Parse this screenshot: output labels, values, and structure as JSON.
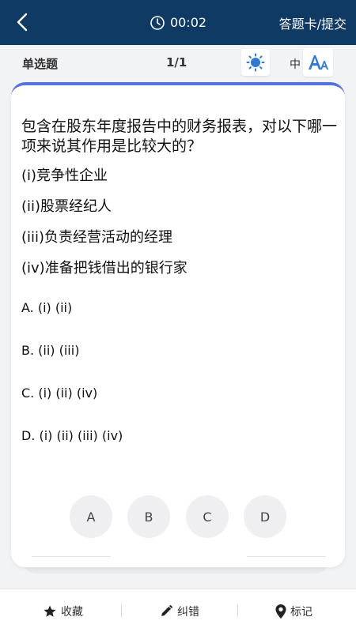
{
  "header": {
    "timer": "00:02",
    "answer_card_label": "答题卡/提交"
  },
  "subheader": {
    "question_type": "单选题",
    "progress": "1/1",
    "font_size_label": "中"
  },
  "question": {
    "stem": "包含在股东年度报告中的财务报表，对以下哪一项来说其作用是比较大的？",
    "statements": [
      "(i)竞争性企业",
      "(ii)股票经纪人",
      "(iii)负责经营活动的经理",
      "(iv)准备把钱借出的银行家"
    ],
    "options": [
      "A.  (i) (ii)",
      "B.  (ii) (iii)",
      "C.  (i) (ii) (iv)",
      "D.  (i) (ii) (iii) (iv)"
    ],
    "choice_buttons": [
      "A",
      "B",
      "C",
      "D"
    ]
  },
  "bottom_bar": {
    "favorite_label": "收藏",
    "correction_label": "纠错",
    "mark_label": "标记"
  },
  "colors": {
    "header_bg": "#0f3a63",
    "accent": "#5573e0",
    "font_icon": "#2f7ad8"
  }
}
